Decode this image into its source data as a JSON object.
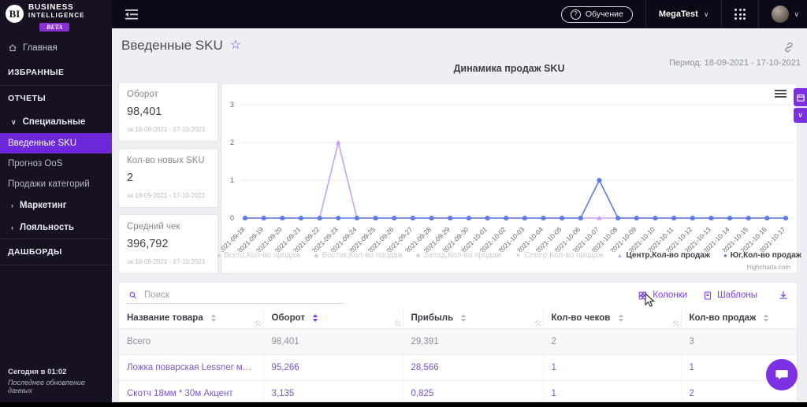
{
  "colors": {
    "accent": "#7c3aed",
    "sidebar_active_bg": "#6d28d9",
    "beta_badge": "#8b2fd6",
    "center_series": "#c9a2f0",
    "south_series": "#5b7ce2",
    "disabled_legend": "#cfd0d6"
  },
  "topbar": {
    "training": "Обучение",
    "account": "MegaTest"
  },
  "sidebar": {
    "logo": {
      "mark": "BI",
      "line1": "BUSINESS",
      "line2": "INTELLIGENCE",
      "badge": "BETA"
    },
    "home": "Главная",
    "sections": {
      "favorites": "ИЗБРАННЫЕ",
      "reports": "ОТЧЕТЫ",
      "dashboards": "ДАШБОРДЫ"
    },
    "groups": {
      "special": "Специальные",
      "marketing": "Маркетинг",
      "loyalty": "Лояльность"
    },
    "items": {
      "sku": "Введенные SKU",
      "oos": "Прогноз OoS",
      "categories": "Продажи категорий"
    },
    "footer": {
      "time": "Сегодня в 01:02",
      "caption": "Последнее обновление данных"
    }
  },
  "header": {
    "title": "Введенные SKU",
    "period": "Период: 18-09-2021 - 17-10-2021"
  },
  "cards": [
    {
      "title": "Оборот",
      "value": "98,401",
      "caption": "за 18-09-2021 - 17-10-2021"
    },
    {
      "title": "Кол-во новых SKU",
      "value": "2",
      "caption": "за 18-09-2021 - 17-10-2021"
    },
    {
      "title": "Средний чек",
      "value": "396,792",
      "caption": "за 18-09-2021 - 17-10-2021"
    }
  ],
  "chart_data": {
    "type": "line",
    "title": "Динамика продаж SKU",
    "x": [
      "2021-09-18",
      "2021-09-19",
      "2021-09-20",
      "2021-09-21",
      "2021-09-22",
      "2021-09-23",
      "2021-09-24",
      "2021-09-25",
      "2021-09-26",
      "2021-09-27",
      "2021-09-28",
      "2021-09-29",
      "2021-09-30",
      "2021-10-01",
      "2021-10-02",
      "2021-10-03",
      "2021-10-04",
      "2021-10-05",
      "2021-10-06",
      "2021-10-07",
      "2021-10-08",
      "2021-10-09",
      "2021-10-10",
      "2021-10-11",
      "2021-10-12",
      "2021-10-13",
      "2021-10-14",
      "2021-10-15",
      "2021-10-16",
      "2021-10-17"
    ],
    "ylim": [
      0,
      3
    ],
    "yticks": [
      0,
      1,
      2,
      3
    ],
    "grid": true,
    "legend_position": "bottom",
    "credits": "Highcharts.com",
    "series": [
      {
        "name": "Всего,Кол-во продаж",
        "visible": false,
        "marker": "circle"
      },
      {
        "name": "Восток,Кол-во продаж",
        "visible": false,
        "marker": "diamond"
      },
      {
        "name": "Запад,Кол-во продаж",
        "visible": false,
        "marker": "square"
      },
      {
        "name": "Север,Кол-во продаж",
        "visible": false,
        "marker": "triangle-down"
      },
      {
        "name": "Центр,Кол-во продаж",
        "visible": true,
        "color": "#c9a2f0",
        "marker": "triangle",
        "values": [
          0,
          0,
          0,
          0,
          0,
          2,
          0,
          0,
          0,
          0,
          0,
          0,
          0,
          0,
          0,
          0,
          0,
          0,
          0,
          0,
          0,
          0,
          0,
          0,
          0,
          0,
          0,
          0,
          0,
          0
        ]
      },
      {
        "name": "Юг,Кол-во продаж",
        "visible": true,
        "color": "#5b7ce2",
        "marker": "circle",
        "values": [
          0,
          0,
          0,
          0,
          0,
          0,
          0,
          0,
          0,
          0,
          0,
          0,
          0,
          0,
          0,
          0,
          0,
          0,
          0,
          1,
          0,
          0,
          0,
          0,
          0,
          0,
          0,
          0,
          0,
          0
        ]
      }
    ]
  },
  "table": {
    "search_placeholder": "Поиск",
    "columns_button": "Колонки",
    "templates_button": "Шаблоны",
    "headers": [
      "Название товара",
      "Оборот",
      "Прибыль",
      "Кол-во чеков",
      "Кол-во продаж"
    ],
    "sorted_column": "Оборот",
    "rows": [
      {
        "name": "Всего",
        "values": [
          "98,401",
          "29,391",
          "2",
          "3"
        ]
      },
      {
        "name": "Ложка поварская Lessner металл Antonia",
        "values": [
          "95,266",
          "28,566",
          "1",
          "1"
        ]
      },
      {
        "name": "Скотч 18мм * 30м Акцент",
        "values": [
          "3,135",
          "0,825",
          "1",
          "2"
        ]
      }
    ]
  }
}
